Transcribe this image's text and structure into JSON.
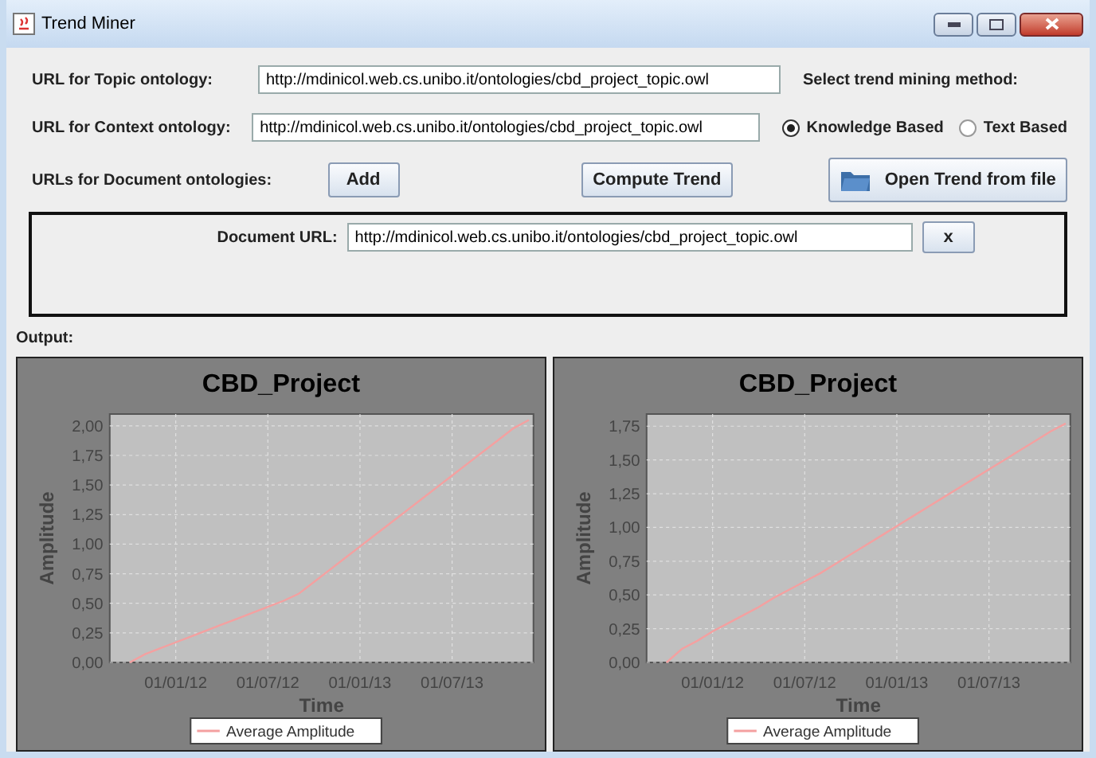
{
  "window": {
    "title": "Trend Miner"
  },
  "topic": {
    "label": "URL for Topic ontology:",
    "value": "http://mdinicol.web.cs.unibo.it/ontologies/cbd_project_topic.owl"
  },
  "context": {
    "label": "URL for Context ontology:",
    "value": "http://mdinicol.web.cs.unibo.it/ontologies/cbd_project_topic.owl"
  },
  "method": {
    "label": "Select trend mining method:",
    "options": [
      {
        "label": "Knowledge Based",
        "selected": true
      },
      {
        "label": "Text Based",
        "selected": false
      }
    ]
  },
  "documents": {
    "label": "URLs for Document ontologies:",
    "add_button": "Add",
    "compute_button": "Compute Trend",
    "open_button": "Open Trend from file"
  },
  "document_rows": [
    {
      "label": "Document URL:",
      "value": "http://mdinicol.web.cs.unibo.it/ontologies/cbd_project_topic.owl",
      "remove_button": "x"
    }
  ],
  "output_label": "Output:",
  "charts": [
    {
      "chart_data": {
        "type": "line",
        "title": "CBD_Project",
        "xlabel": "Time",
        "ylabel": "Amplitude",
        "categories": [
          null,
          null,
          null,
          null,
          "01/01/12",
          null,
          null,
          null,
          null,
          null,
          "01/07/12",
          null,
          null,
          null,
          null,
          null,
          "01/01/13",
          null,
          null,
          null,
          null,
          null,
          "01/07/13",
          null,
          null,
          null,
          null,
          null
        ],
        "series": [
          {
            "name": "Average Amplitude",
            "color": "#f4a0a0",
            "values": [
              null,
              0.0,
              0.07,
              0.12,
              0.17,
              0.22,
              0.27,
              0.32,
              0.37,
              0.42,
              0.47,
              0.52,
              0.58,
              0.68,
              0.78,
              0.88,
              0.98,
              1.08,
              1.18,
              1.28,
              1.38,
              1.48,
              1.58,
              1.68,
              1.78,
              1.88,
              1.98,
              2.05
            ]
          }
        ],
        "grid": true,
        "ylim": [
          0,
          2.1
        ],
        "yticks": [
          {
            "value": 0,
            "label": "0,00"
          },
          {
            "value": 0.25,
            "label": "0,25"
          },
          {
            "value": 0.5,
            "label": "0,50"
          },
          {
            "value": 0.75,
            "label": "0,75"
          },
          {
            "value": 1,
            "label": "1,00"
          },
          {
            "value": 1.25,
            "label": "1,25"
          },
          {
            "value": 1.5,
            "label": "1,50"
          },
          {
            "value": 1.75,
            "label": "1,75"
          },
          {
            "value": 2,
            "label": "2,00"
          }
        ]
      }
    },
    {
      "chart_data": {
        "type": "line",
        "title": "CBD_Project",
        "xlabel": "Time",
        "ylabel": "Amplitude",
        "categories": [
          null,
          null,
          null,
          null,
          "01/01/12",
          null,
          null,
          null,
          null,
          null,
          "01/07/12",
          null,
          null,
          null,
          null,
          null,
          "01/01/13",
          null,
          null,
          null,
          null,
          null,
          "01/07/13",
          null,
          null,
          null,
          null,
          null
        ],
        "series": [
          {
            "name": "Average Amplitude",
            "color": "#f4a0a0",
            "values": [
              null,
              0.0,
              0.1,
              0.16,
              0.23,
              0.29,
              0.35,
              0.41,
              0.48,
              0.54,
              0.6,
              0.66,
              0.73,
              0.8,
              0.87,
              0.94,
              1.01,
              1.08,
              1.15,
              1.22,
              1.29,
              1.36,
              1.43,
              1.5,
              1.57,
              1.64,
              1.71,
              1.77
            ]
          }
        ],
        "grid": true,
        "ylim": [
          0,
          1.84
        ],
        "yticks": [
          {
            "value": 0,
            "label": "0,00"
          },
          {
            "value": 0.25,
            "label": "0,25"
          },
          {
            "value": 0.5,
            "label": "0,50"
          },
          {
            "value": 0.75,
            "label": "0,75"
          },
          {
            "value": 1,
            "label": "1,00"
          },
          {
            "value": 1.25,
            "label": "1,25"
          },
          {
            "value": 1.5,
            "label": "1,50"
          },
          {
            "value": 1.75,
            "label": "1,75"
          }
        ]
      }
    }
  ]
}
